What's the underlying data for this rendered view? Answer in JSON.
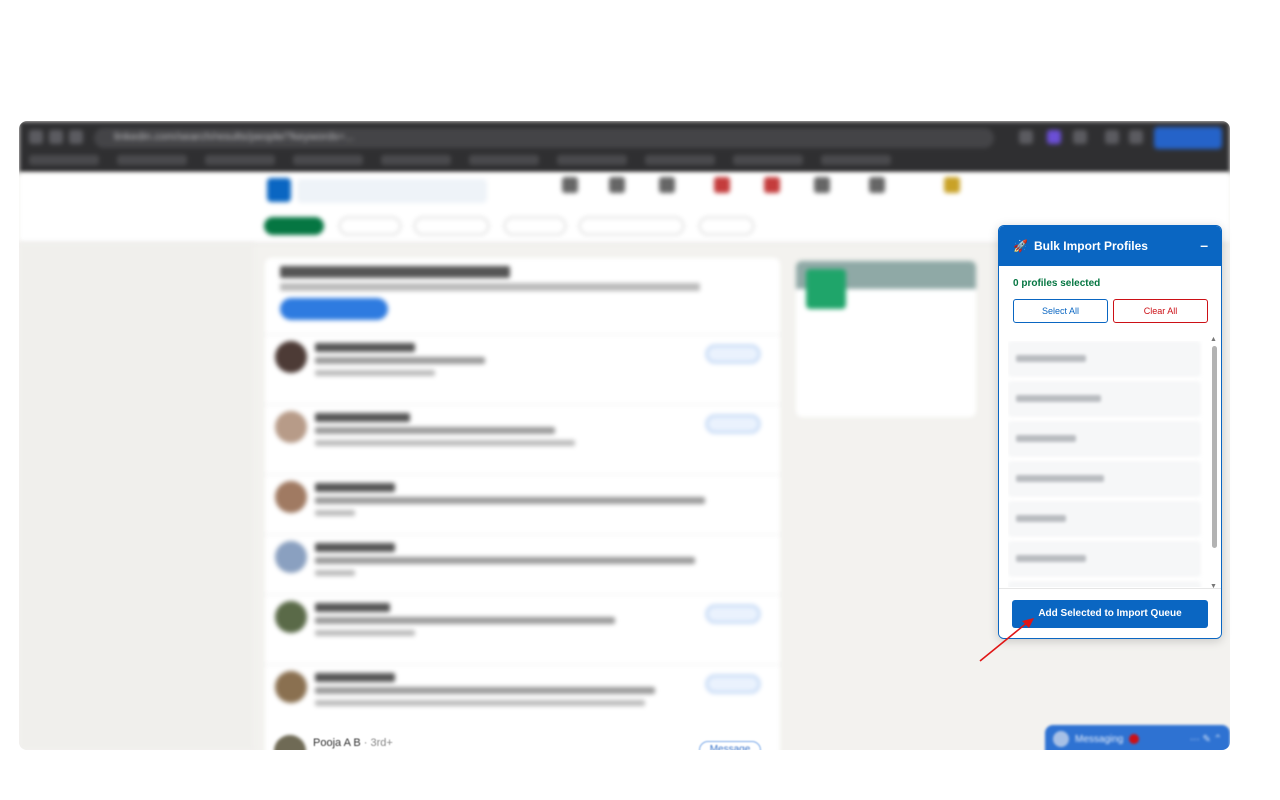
{
  "browser": {
    "url": "linkedin.com/search/results/people/?keywords=..."
  },
  "feed": {
    "last_row": {
      "name": "Pooja A B",
      "degree": "· 3rd+",
      "message_label": "Message"
    }
  },
  "messaging": {
    "label": "Messaging",
    "badge": "1",
    "tools": "···  ✎  ⌃"
  },
  "panel": {
    "rocket_icon": "🚀",
    "title": "Bulk Import Profiles",
    "minimize_label": "–",
    "count_text": "0 profiles selected",
    "select_all_label": "Select All",
    "clear_all_label": "Clear All",
    "add_button_label": "Add Selected to Import Queue",
    "scroll_up": "▲",
    "scroll_down": "▼"
  },
  "colors": {
    "accent": "#0a66c2",
    "success": "#057642",
    "danger": "#cc1016",
    "arrow": "#e01616"
  },
  "icons": {
    "panel": "rocket-icon",
    "close": "minimize-icon",
    "annotation": "arrow-pointer-icon"
  }
}
